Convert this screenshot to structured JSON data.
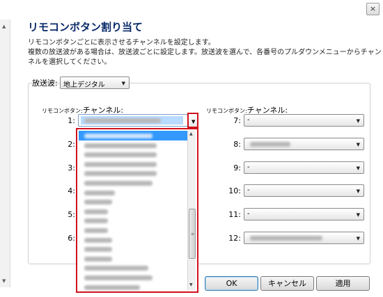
{
  "window": {
    "close_glyph": "×"
  },
  "title": "リモコンボタン割り当て",
  "description": [
    "リモコンボタンごとに表示させるチャンネルを設定します。",
    "複数の放送波がある場合は、放送波ごとに設定します。放送波を選んで、各番号のプルダウンメニューからチャン",
    "ネルを選択してください。"
  ],
  "broadcast": {
    "label": "放送波:",
    "selected": "地上デジタル"
  },
  "column_header": {
    "prefix": "リモコンボタン:",
    "suffix": "チャンネル:"
  },
  "left_buttons": [
    "1:",
    "2:",
    "3:",
    "4:",
    "5:",
    "6:"
  ],
  "right_buttons": [
    {
      "label": "7:",
      "value": "-"
    },
    {
      "label": "8:",
      "value": ""
    },
    {
      "label": "9:",
      "value": "-"
    },
    {
      "label": "10:",
      "value": "-"
    },
    {
      "label": "11:",
      "value": "-"
    },
    {
      "label": "12:",
      "value": ""
    }
  ],
  "dropdown_item_count": 17,
  "buttons": {
    "ok": "OK",
    "cancel": "キャンセル",
    "apply": "適用"
  },
  "icons": {
    "arrow_down": "▼",
    "arrow_up": "▲",
    "grip": "≡"
  },
  "colors": {
    "title": "#0a2a6a",
    "highlight": "#d0101c",
    "selection": "#3399ff"
  }
}
